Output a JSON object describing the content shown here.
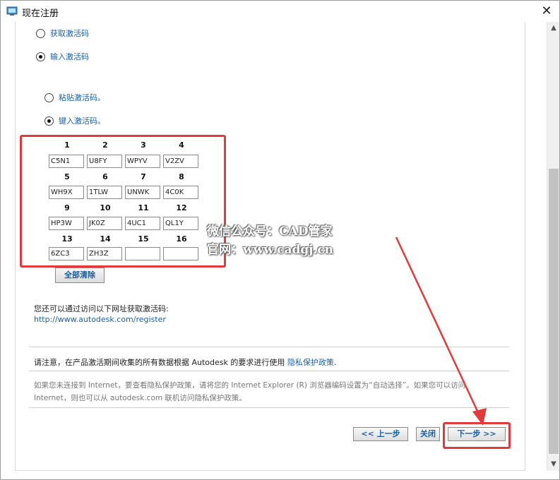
{
  "window": {
    "title": "现在注册",
    "close_glyph": "✕"
  },
  "options": {
    "get_code": "获取激活码",
    "enter_code": "输入激活码",
    "paste_code": "粘贴激活码。",
    "type_code": "键入激活码。"
  },
  "code_grid": {
    "numbers": [
      "1",
      "2",
      "3",
      "4",
      "5",
      "6",
      "7",
      "8",
      "9",
      "10",
      "11",
      "12",
      "13",
      "14",
      "15",
      "16"
    ],
    "values": [
      "C5N1",
      "U8FY",
      "WPYV",
      "V2ZV",
      "WH9X",
      "1TLW",
      "UNWK",
      "4C0K",
      "HP3W",
      "JK0Z",
      "4UC1",
      "QL1Y",
      "6ZC3",
      "ZH3Z",
      "",
      ""
    ]
  },
  "clear_all_label": "全部清除",
  "info": {
    "text": "您还可以通过访问以下网址获取激活码:",
    "url": "http://www.autodesk.com/register"
  },
  "privacy": {
    "note_prefix": "请注意，在产品激活期间收集的所有数据根据 Autodesk 的要求进行使用 ",
    "note_link": "隐私保护政策",
    "note_suffix": ".",
    "gray_line1": "如果您未连接到 Internet，要查看隐私保护政策，请将您的 Internet Explorer (R) 浏览器编码设置为“自动选择”。如果您可以访问",
    "gray_line2": "Internet，则也可以从 autodesk.com 联机访问隐私保护政策。"
  },
  "buttons": {
    "back": "<< 上一步",
    "close": "关闭",
    "next": "下一步 >>"
  },
  "watermark": {
    "line1": "微信公众号：CAD管家",
    "line2": "官网：www.cadgj.cn"
  },
  "colors": {
    "accent": "#1a5fa0",
    "highlight_red": "#e23a3a"
  },
  "icons": {
    "app": "window-icon",
    "close": "close-icon",
    "scroll_up": "chevron-up-icon",
    "scroll_down": "chevron-down-icon"
  }
}
